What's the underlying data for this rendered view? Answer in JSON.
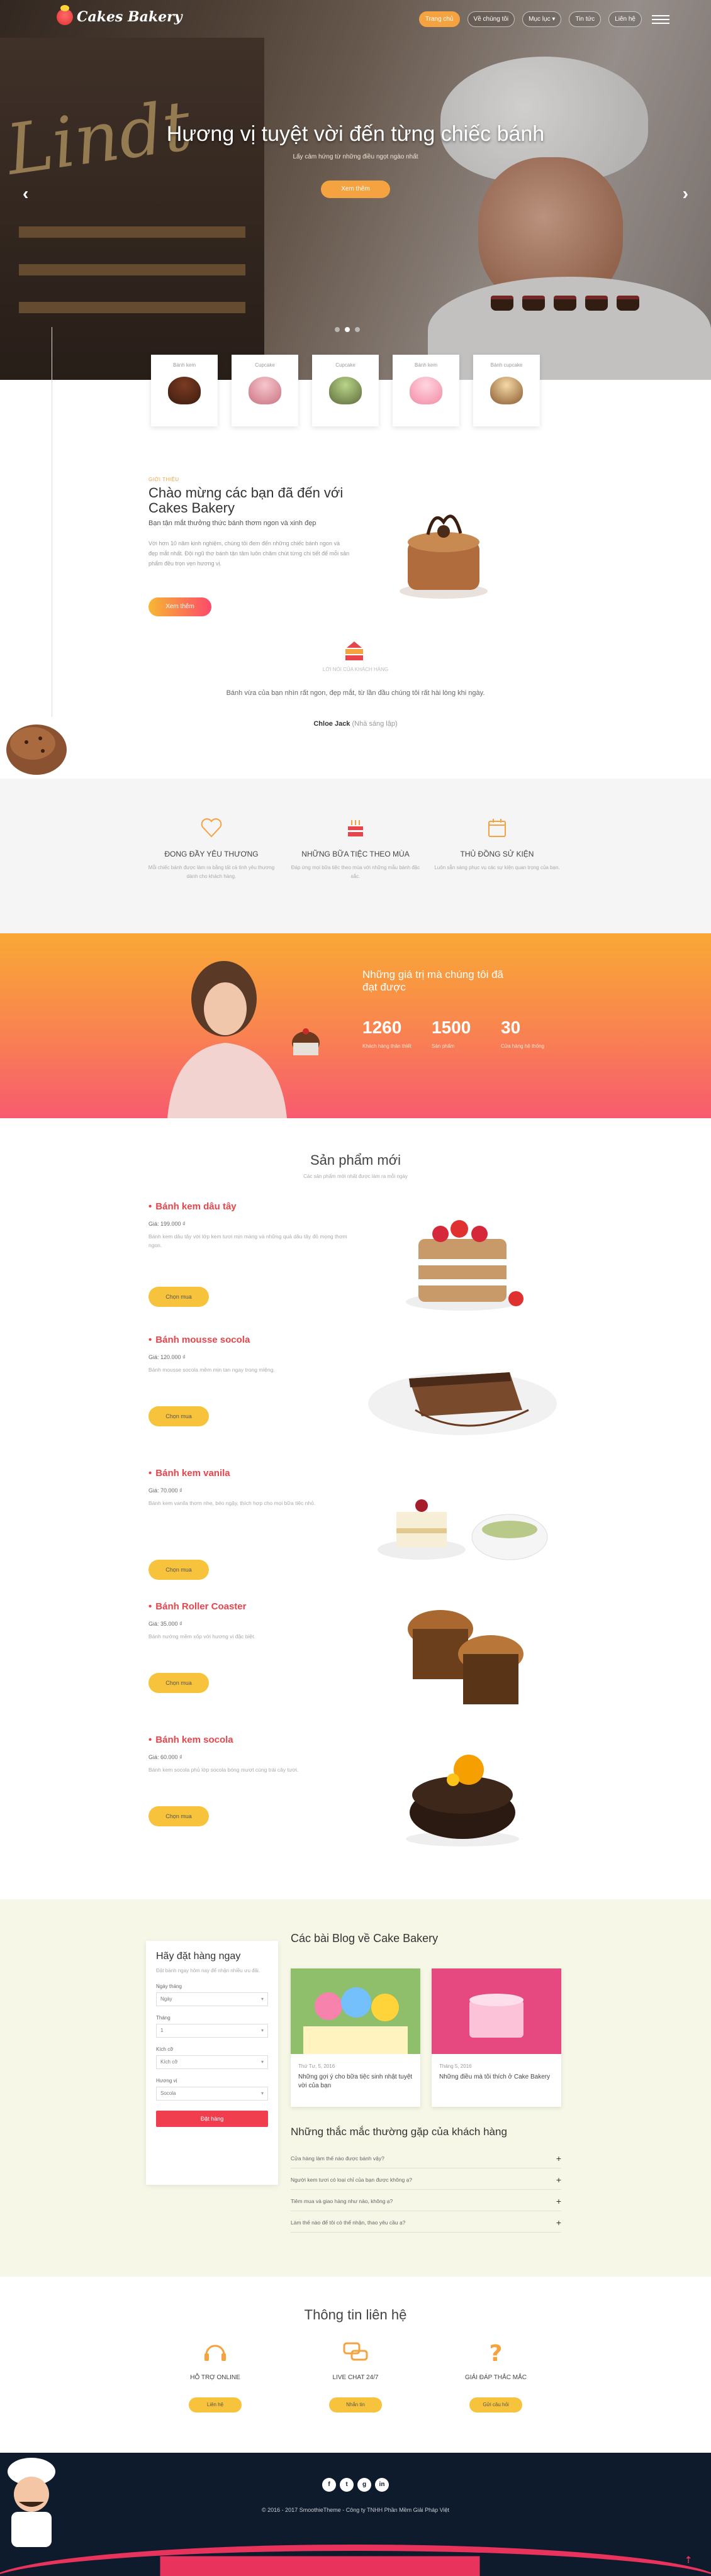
{
  "brand": {
    "name": "Cakes Bakery",
    "accent": "#f4a340",
    "red": "#e8444c"
  },
  "nav": {
    "items": [
      {
        "label": "Trang chủ",
        "active": true
      },
      {
        "label": "Về chúng tôi",
        "active": false
      },
      {
        "label": "Mục lục ▾",
        "active": false
      },
      {
        "label": "Tin tức",
        "active": false
      },
      {
        "label": "Liên hệ",
        "active": false
      }
    ]
  },
  "hero": {
    "title": "Hương vị tuyệt vời đến từng chiếc bánh",
    "subtitle": "Lấy cảm hứng từ những điều ngọt ngào nhất",
    "button": "Xem thêm",
    "prev": "‹",
    "next": "›",
    "slides": 3,
    "active_slide": 1
  },
  "categories": [
    {
      "label": "Bánh kem"
    },
    {
      "label": "Cupcake"
    },
    {
      "label": "Cupcake"
    },
    {
      "label": "Bánh kem"
    },
    {
      "label": "Bánh cupcake"
    }
  ],
  "welcome": {
    "kicker": "GIỚI THIỆU",
    "title": "Chào mừng các bạn đã đến với Cakes Bakery",
    "lead": "Bạn tận mắt thưởng thức bánh thơm ngon và xinh đẹp",
    "body": "Với hơn 10 năm kinh nghiệm, chúng tôi đem đến những chiếc bánh ngon và đẹp mắt nhất. Đội ngũ thợ bánh tận tâm luôn chăm chút từng chi tiết để mỗi sản phẩm đều trọn vẹn hương vị.",
    "button": "Xem thêm"
  },
  "quote": {
    "kicker": "LỜI NÓI CỦA KHÁCH HÀNG",
    "text": "Bánh vừa của bạn nhìn rất ngon, đẹp mắt, từ lần đầu chúng tôi rất hài lòng khi ngày.",
    "author": "Chloe Jack",
    "author_role": "(Nhà sáng lập)"
  },
  "features": [
    {
      "title": "ĐONG ĐẦY YÊU THƯƠNG",
      "desc": "Mỗi chiếc bánh được làm ra bằng tất cả tình yêu thương dành cho khách hàng."
    },
    {
      "title": "NHỮNG BỮA TIỆC THEO MÙA",
      "desc": "Đáp ứng mọi bữa tiệc theo mùa với những mẫu bánh đặc sắc."
    },
    {
      "title": "THỦ ĐỒNG SỬ KIỆN",
      "desc": "Luôn sẵn sàng phục vụ các sự kiện quan trọng của bạn."
    }
  ],
  "stats": {
    "title": "Những giá trị mà chúng tôi đã đạt được",
    "items": [
      {
        "number": "1260",
        "label": "Khách hàng thân thiết"
      },
      {
        "number": "1500",
        "label": "Sản phẩm"
      },
      {
        "number": "30",
        "label": "Cửa hàng hệ thống"
      }
    ]
  },
  "products": {
    "title": "Sản phẩm mới",
    "subtitle": "Các sản phẩm mới nhất được làm ra mỗi ngày",
    "items": [
      {
        "name": "Bánh kem dâu tây",
        "price": "Giá: 199.000 ₫",
        "desc": "Bánh kem dâu tây với lớp kem tươi mịn màng và những quả dâu tây đỏ mọng thơm ngon.",
        "button": "Chọn mua"
      },
      {
        "name": "Bánh mousse socola",
        "price": "Giá: 120.000 ₫",
        "desc": "Bánh mousse socola mềm mịn tan ngay trong miệng.",
        "button": "Chọn mua"
      },
      {
        "name": "Bánh kem vanila",
        "price": "Giá: 70.000 ₫",
        "desc": "Bánh kem vanila thơm nhẹ, béo ngậy, thích hợp cho mọi bữa tiệc nhỏ.",
        "button": "Chọn mua"
      },
      {
        "name": "Bánh Roller Coaster",
        "price": "Giá: 35.000 ₫",
        "desc": "Bánh nướng mềm xốp với hương vị đặc biệt.",
        "button": "Chọn mua"
      },
      {
        "name": "Bánh kem socola",
        "price": "Giá: 60.000 ₫",
        "desc": "Bánh kem socola phủ lớp socola bóng mượt cùng trái cây tươi.",
        "button": "Chọn mua"
      }
    ]
  },
  "order": {
    "title": "Hãy đặt hàng ngay",
    "desc": "Đặt bánh ngay hôm nay để nhận nhiều ưu đãi.",
    "fields": [
      {
        "label": "Ngày tháng",
        "value": "Ngày"
      },
      {
        "label": "Tháng",
        "value": "1"
      },
      {
        "label": "Kích cỡ",
        "value": "Kích cỡ"
      },
      {
        "label": "Hương vị",
        "value": "Socola"
      }
    ],
    "submit": "Đặt hàng"
  },
  "blog": {
    "title": "Các bài Blog về Cake Bakery",
    "posts": [
      {
        "date": "Thứ Tư, 5, 2016",
        "title": "Những gợi ý cho bữa tiệc sinh nhật tuyệt vời của bạn"
      },
      {
        "date": "Tháng 5, 2016",
        "title": "Những điều mà tôi thích ở Cake Bakery"
      }
    ]
  },
  "faq": {
    "title": "Những thắc mắc thường gặp của khách hàng",
    "items": [
      {
        "q": "Cửa hàng làm thế nào được bánh vậy?"
      },
      {
        "q": "Người kem tươi có loại chỉ của bạn được không ạ?"
      },
      {
        "q": "Tiêm mua và giao hàng như nào, không ạ?"
      },
      {
        "q": "Làm thế nào để tôi có thể nhận, thao yêu cầu ạ?"
      }
    ]
  },
  "contact": {
    "title": "Thông tin liên hệ",
    "items": [
      {
        "label": "HỖ TRỢ ONLINE",
        "button": "Liên hệ"
      },
      {
        "label": "LIVE CHAT 24/7",
        "button": "Nhắn tin"
      },
      {
        "label": "GIẢI ĐÁP THẮC MẮC",
        "button": "Gửi câu hỏi"
      }
    ]
  },
  "footer": {
    "social": [
      "f",
      "t",
      "g",
      "in"
    ],
    "copyright": "© 2016 - 2017 SmoothieTheme - Công ty TNHH Phần Mềm Giải Pháp Việt",
    "to_top": "⇡"
  }
}
